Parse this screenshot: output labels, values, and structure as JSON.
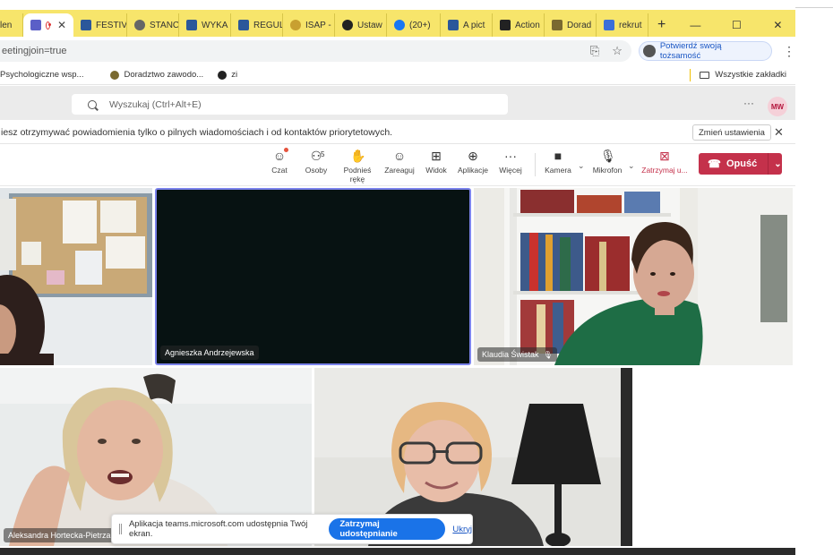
{
  "tabs": [
    {
      "label": "len",
      "icon": "teams-icon",
      "color": "#f0a020"
    },
    {
      "label": "",
      "icon": "teams-icon",
      "color": "#5b5fc7",
      "active": true,
      "recording": true
    },
    {
      "label": "FESTIV",
      "icon": "word-icon",
      "color": "#2b579a"
    },
    {
      "label": "STANC",
      "icon": "globe-icon",
      "color": "#666666"
    },
    {
      "label": "WYKA",
      "icon": "word-icon",
      "color": "#2b579a"
    },
    {
      "label": "REGUL",
      "icon": "word-icon",
      "color": "#2b579a"
    },
    {
      "label": "ISAP -",
      "icon": "isap-icon",
      "color": "#c8a030"
    },
    {
      "label": "Ustaw",
      "icon": "circle-icon",
      "color": "#222222"
    },
    {
      "label": "(20+)",
      "icon": "facebook-icon",
      "color": "#1877f2"
    },
    {
      "label": "A pict",
      "icon": "word-icon",
      "color": "#2b579a"
    },
    {
      "label": "Action",
      "icon": "action-icon",
      "color": "#222222"
    },
    {
      "label": "Dorad",
      "icon": "crown-icon",
      "color": "#7a6a30"
    },
    {
      "label": "rekrut",
      "icon": "shield-icon",
      "color": "#3b6fd8"
    }
  ],
  "new_tab_symbol": "+",
  "window_controls": {
    "minimize": "—",
    "maximize": "☐",
    "close": "✕"
  },
  "address": {
    "url": "eetingjoin=true",
    "verify_label": "Potwierdź swoją tożsamość"
  },
  "bookmarks": {
    "items": [
      {
        "label": "Psychologiczne wsp...",
        "color": "#888888"
      },
      {
        "label": "Doradztwo zawodo...",
        "color": "#7a6a30"
      },
      {
        "label": "zi",
        "color": "#222222"
      }
    ],
    "all_label": "Wszystkie zakładki"
  },
  "teams": {
    "search_placeholder": "Wyszukaj (Ctrl+Alt+E)",
    "more": "···",
    "avatar_initials": "MW"
  },
  "notification": {
    "text": "iesz otrzymywać powiadomienia tylko o pilnych wiadomościach i od kontaktów priorytetowych.",
    "change_label": "Zmień ustawienia",
    "close": "✕"
  },
  "toolbar": {
    "chat": "Czat",
    "people": "Osoby",
    "people_count": "5",
    "raise_hand": "Podnieś rękę",
    "react": "Zareaguj",
    "view": "Widok",
    "apps": "Aplikacje",
    "more": "Więcej",
    "camera": "Kamera",
    "mic": "Mikrofon",
    "stop_share": "Zatrzymaj u...",
    "leave": "Opuść"
  },
  "participants": [
    {
      "name": ""
    },
    {
      "name": "Agnieszka Andrzejewska"
    },
    {
      "name": "Klaudia Świstak",
      "muted": true
    },
    {
      "name": "Aleksandra Hortecka-Pietrzak"
    },
    {
      "name": ""
    }
  ],
  "share_banner": {
    "text": "Aplikacja teams.microsoft.com udostępnia Twój ekran.",
    "stop_label": "Zatrzymaj udostępnianie",
    "hide_label": "Ukryj"
  },
  "colors": {
    "tabbar": "#f7e56b",
    "leave_button": "#c4314b",
    "share_button": "#1a73e8",
    "active_speaker_border": "#7b83eb"
  }
}
